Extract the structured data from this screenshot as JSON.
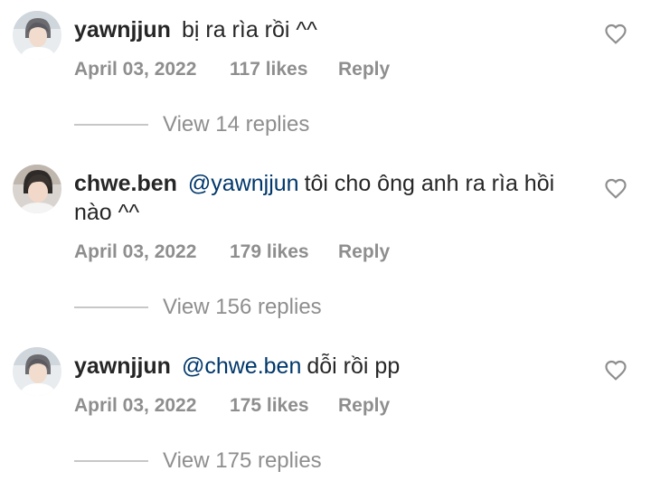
{
  "comments": [
    {
      "username": "yawnjjun",
      "mention": "",
      "text": "bị ra rìa rồi ^^",
      "date": "April 03, 2022",
      "likes": "117 likes",
      "reply_label": "Reply",
      "view_replies": "View 14 replies",
      "avatar_icon": "profile-photo-icon",
      "like_icon": "heart-outline-icon"
    },
    {
      "username": "chwe.ben",
      "mention": "@yawnjjun",
      "text": "tôi cho ông anh ra rìa hồi nào ^^",
      "date": "April 03, 2022",
      "likes": "179 likes",
      "reply_label": "Reply",
      "view_replies": "View 156 replies",
      "avatar_icon": "profile-photo-icon",
      "like_icon": "heart-outline-icon"
    },
    {
      "username": "yawnjjun",
      "mention": "@chwe.ben",
      "text": "dỗi rồi pp",
      "date": "April 03, 2022",
      "likes": "175 likes",
      "reply_label": "Reply",
      "view_replies": "View 175 replies",
      "avatar_icon": "profile-photo-icon",
      "like_icon": "heart-outline-icon"
    }
  ],
  "colors": {
    "text": "#262626",
    "secondary": "#8e8e8e",
    "mention": "#00376b",
    "divider": "#c7c7c7"
  }
}
